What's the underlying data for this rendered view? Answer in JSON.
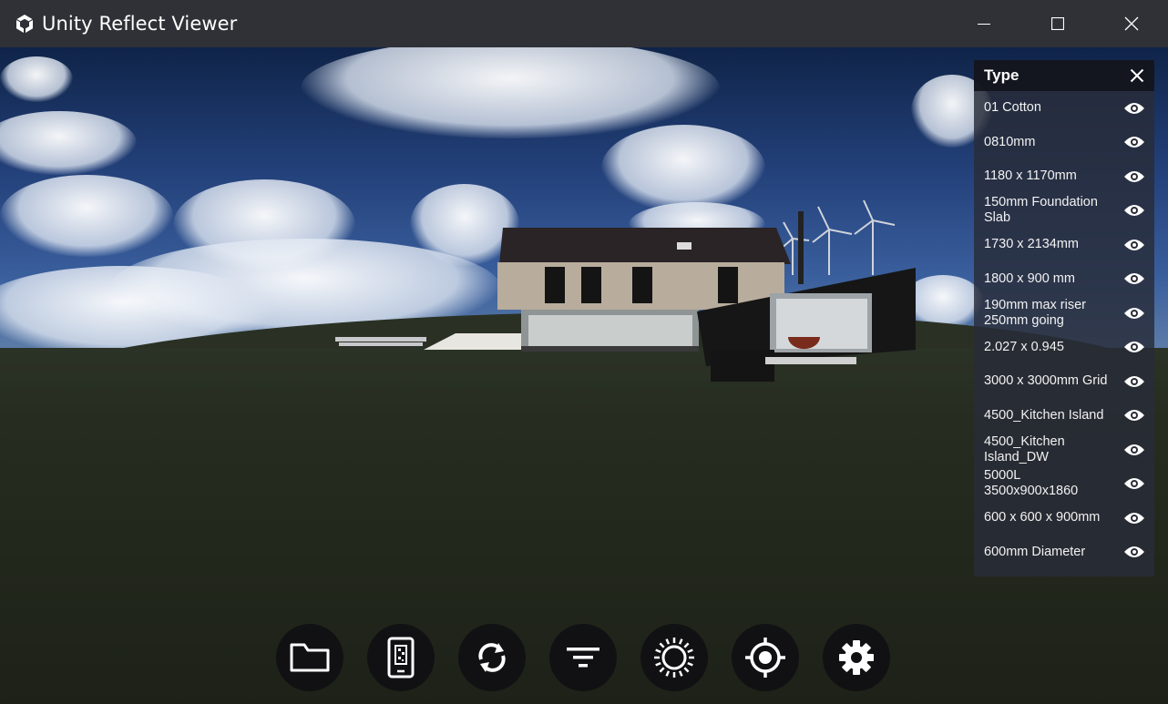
{
  "window": {
    "title": "Unity Reflect Viewer",
    "controls": [
      "minimize-icon",
      "maximize-icon",
      "close-icon"
    ]
  },
  "filter_panel": {
    "title": "Type",
    "items": [
      {
        "label": "01 Cotton",
        "visible": true
      },
      {
        "label": "0810mm",
        "visible": true
      },
      {
        "label": "1180 x 1170mm",
        "visible": true
      },
      {
        "label": "150mm Foundation Slab",
        "visible": true
      },
      {
        "label": "1730 x 2134mm",
        "visible": true
      },
      {
        "label": "1800 x 900 mm",
        "visible": true
      },
      {
        "label": "190mm max riser 250mm going",
        "visible": true
      },
      {
        "label": "2.027 x 0.945",
        "visible": true
      },
      {
        "label": "3000 x 3000mm Grid",
        "visible": true
      },
      {
        "label": "4500_Kitchen Island",
        "visible": true
      },
      {
        "label": "4500_Kitchen Island_DW",
        "visible": true
      },
      {
        "label": "5000L 3500x900x1860",
        "visible": true
      },
      {
        "label": "600 x 600 x 900mm",
        "visible": true
      },
      {
        "label": "600mm Diameter",
        "visible": true
      }
    ]
  },
  "toolbar": {
    "buttons": [
      "folder-icon",
      "phone-qr-icon",
      "sync-icon",
      "filter-icon",
      "sun-icon",
      "target-icon",
      "gear-icon"
    ]
  },
  "colors": {
    "titlebar": "#2f3137",
    "panel_header": "#12141c",
    "tool_button": "#101012"
  }
}
